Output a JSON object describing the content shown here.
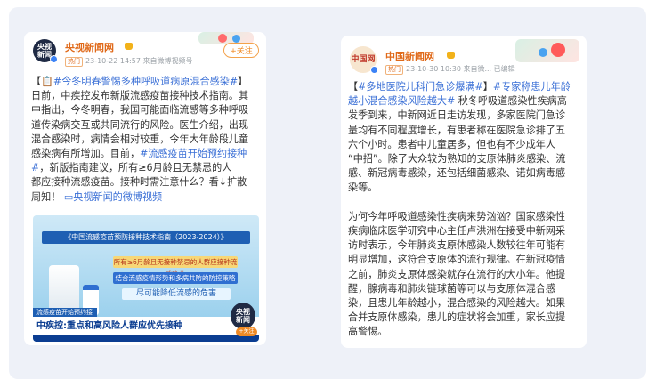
{
  "left_post": {
    "avatar_text": "央视\n新闻",
    "author": "央视新闻网",
    "hot_badge": "热门",
    "time": "23-10-22 14:57",
    "source": "来自微博视频号",
    "follow_label": "+关注",
    "text_lines": [
      {
        "parts": [
          {
            "t": "【",
            "c": ""
          },
          {
            "t": "📋#今冬明春警惕多种呼吸道病原混合感染#",
            "c": "tag"
          },
          {
            "t": "】",
            "c": ""
          }
        ]
      },
      {
        "parts": [
          {
            "t": "日前，中疾控发布新版流感疫苗接种技术指南。其",
            "c": ""
          }
        ]
      },
      {
        "parts": [
          {
            "t": "中指出，今冬明春，我国可能面临流感等多种呼吸",
            "c": ""
          }
        ]
      },
      {
        "parts": [
          {
            "t": "道传染病交互或共同流行的风险。医生介绍，出现",
            "c": ""
          }
        ]
      },
      {
        "parts": [
          {
            "t": "混合感染时，病情会相对较重，今年大年龄段儿童",
            "c": ""
          }
        ]
      },
      {
        "parts": [
          {
            "t": "感染病有所增加。目前，",
            "c": ""
          },
          {
            "t": "#流感疫苗开始预约接种",
            "c": "tag"
          }
        ]
      },
      {
        "parts": [
          {
            "t": "#",
            "c": "tag"
          },
          {
            "t": "，新版指南建议，所有≥6月龄且无禁忌的人",
            "c": ""
          }
        ]
      },
      {
        "parts": [
          {
            "t": "都应接种流感疫苗。接种时需注意什么？看↓扩散",
            "c": ""
          }
        ]
      },
      {
        "parts": [
          {
            "t": "周知！ ",
            "c": ""
          },
          {
            "t": "▭央视新闻的微博视频",
            "c": "link"
          }
        ]
      }
    ],
    "video": {
      "banner": "《中国流感疫苗预防接种技术指南（2023-2024）》",
      "bar1": "所有≥6月龄且无接种禁忌的人群应接种流感疫苗",
      "bar2": "结合流感疫情形势和多病共防的防控策略",
      "bar3": "尽可能降低流感的危害",
      "play_label": "流感疫苗开始预约接种",
      "lower_third": "中疾控:重点和高风险人群应优先接种",
      "corner_logo": "央视\n新闻",
      "corner_button": "+关注"
    }
  },
  "right_post": {
    "avatar_text": "中国网",
    "author": "中国新闻网",
    "hot_badge": "热门",
    "time": "23-10-30 10:30",
    "source": "来自微...",
    "edited": "已编辑",
    "text_lines": [
      {
        "parts": [
          {
            "t": "【",
            "c": ""
          },
          {
            "t": "#多地医院儿科门急诊爆满#",
            "c": "tag"
          },
          {
            "t": "】",
            "c": ""
          },
          {
            "t": "#专家称患儿年龄",
            "c": "tag"
          }
        ]
      },
      {
        "parts": [
          {
            "t": "越小混合感染风险越大#",
            "c": "tag"
          },
          {
            "t": " 秋冬呼吸道感染性疾病高",
            "c": ""
          }
        ]
      },
      {
        "parts": [
          {
            "t": "发季到来，中新网近日走访发现，多家医院门急诊",
            "c": ""
          }
        ]
      },
      {
        "parts": [
          {
            "t": "量均有不同程度增长，有患者称在医院急诊排了五",
            "c": ""
          }
        ]
      },
      {
        "parts": [
          {
            "t": "六个小时。患者中儿童居多，但也有不少成年人",
            "c": ""
          }
        ]
      },
      {
        "parts": [
          {
            "t": "“中招”。除了大众较为熟知的支原体肺炎感染、流",
            "c": ""
          }
        ]
      },
      {
        "parts": [
          {
            "t": "感、新冠病毒感染，还包括细菌感染、诺如病毒感",
            "c": ""
          }
        ]
      },
      {
        "parts": [
          {
            "t": "染等。",
            "c": ""
          }
        ]
      },
      {
        "parts": [
          {
            "t": " ",
            "c": ""
          }
        ]
      },
      {
        "parts": [
          {
            "t": "为何今年呼吸道感染性疾病来势汹汹？国家感染性",
            "c": ""
          }
        ]
      },
      {
        "parts": [
          {
            "t": "疾病临床医学研究中心主任卢洪洲在接受中新网采",
            "c": ""
          }
        ]
      },
      {
        "parts": [
          {
            "t": "访时表示，今年肺炎支原体感染人数较往年可能有",
            "c": ""
          }
        ]
      },
      {
        "parts": [
          {
            "t": "明显增加，这符合支原体的流行规律。在新冠疫情",
            "c": ""
          }
        ]
      },
      {
        "parts": [
          {
            "t": "之前，肺炎支原体感染就存在流行的大小年。他提",
            "c": ""
          }
        ]
      },
      {
        "parts": [
          {
            "t": "醒，腺病毒和肺炎链球菌等可以与支原体混合感",
            "c": ""
          }
        ]
      },
      {
        "parts": [
          {
            "t": "染，且患儿年龄越小，混合感染的风险越大。如果",
            "c": ""
          }
        ]
      },
      {
        "parts": [
          {
            "t": "合并支原体感染，患儿的症状将会加重，家长应提",
            "c": ""
          }
        ]
      },
      {
        "parts": [
          {
            "t": "高警惕。",
            "c": ""
          }
        ]
      }
    ]
  },
  "colors": {
    "author": "#e06a1a",
    "topic_link": "#3a6fd6",
    "body_text": "#333333",
    "frame_bg": "#eef1f8"
  }
}
